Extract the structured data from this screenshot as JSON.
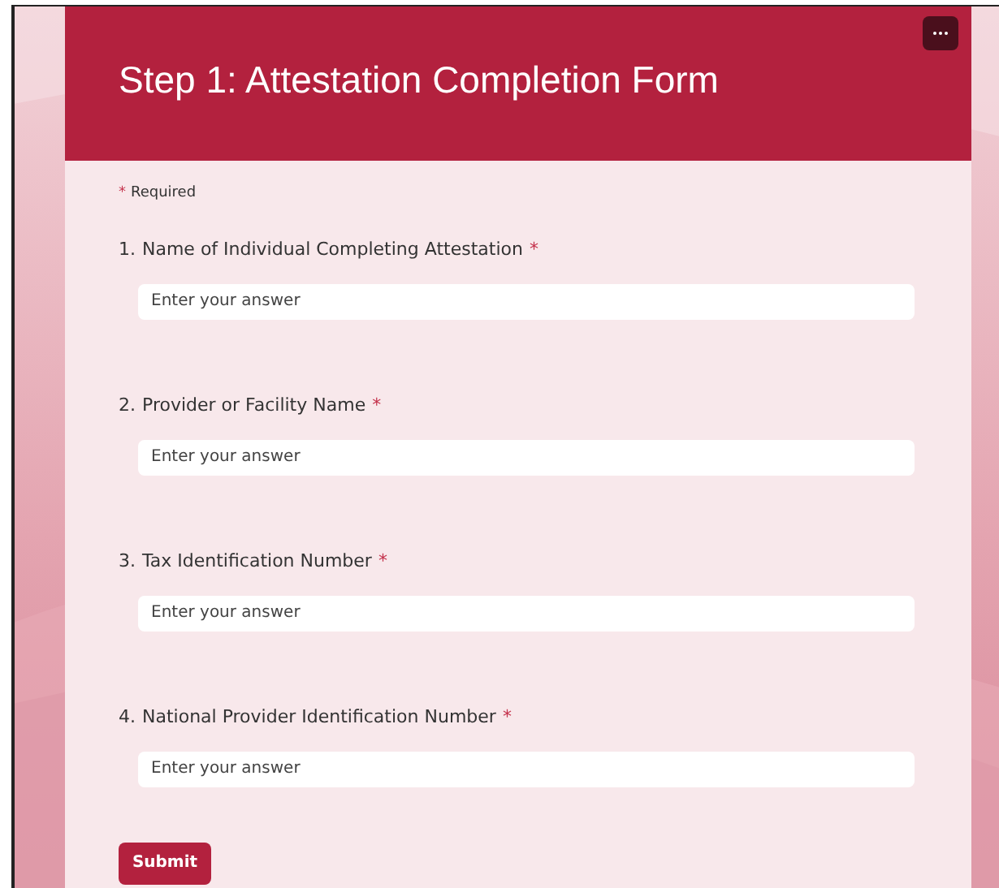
{
  "form": {
    "title": "Step 1: Attestation Completion Form",
    "required_note": {
      "mark": "*",
      "text": "Required"
    },
    "questions": [
      {
        "number": "1.",
        "label": "Name of Individual Completing Attestation",
        "required_mark": "*",
        "placeholder": "Enter your answer"
      },
      {
        "number": "2.",
        "label": "Provider or Facility Name",
        "required_mark": "*",
        "placeholder": "Enter your answer"
      },
      {
        "number": "3.",
        "label": "Tax Identification Number",
        "required_mark": "*",
        "placeholder": "Enter your answer"
      },
      {
        "number": "4.",
        "label": "National Provider Identification Number",
        "required_mark": "*",
        "placeholder": "Enter your answer"
      }
    ],
    "submit": "Submit"
  }
}
